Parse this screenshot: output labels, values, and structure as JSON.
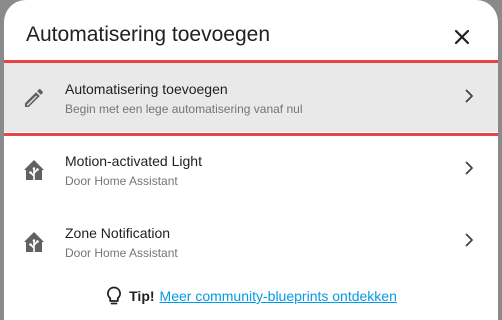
{
  "dialog": {
    "title": "Automatisering toevoegen",
    "close_icon": "close-icon"
  },
  "items": [
    {
      "title": "Automatisering toevoegen",
      "subtitle": "Begin met een lege automatisering vanaf nul",
      "icon": "pencil-icon",
      "highlighted": true
    },
    {
      "title": "Motion-activated Light",
      "subtitle": "Door Home Assistant",
      "icon": "home-assistant-icon"
    },
    {
      "title": "Zone Notification",
      "subtitle": "Door Home Assistant",
      "icon": "home-assistant-icon"
    }
  ],
  "tip": {
    "label": "Tip!",
    "link_text": "Meer community-blueprints ontdekken",
    "icon": "lightbulb-icon"
  },
  "colors": {
    "highlight_border": "#e64545",
    "highlight_bg": "#e9e9e9",
    "link": "#039be5",
    "backdrop": "#8a8a8a"
  }
}
